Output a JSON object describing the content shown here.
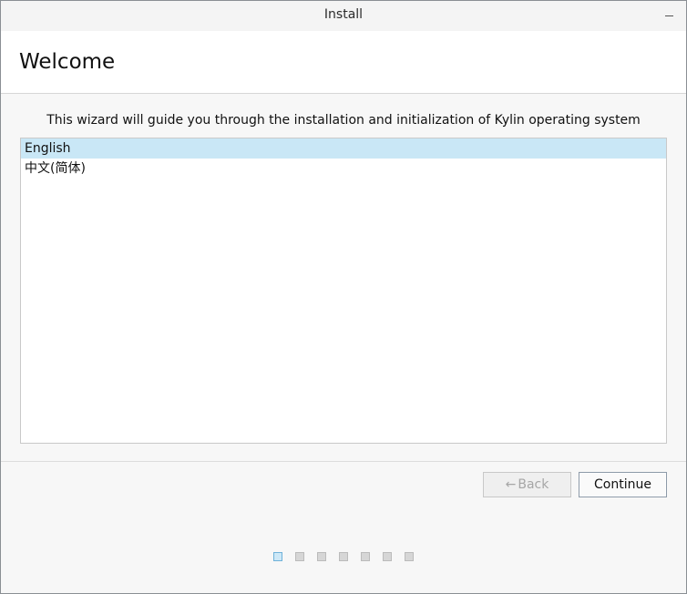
{
  "window": {
    "title": "Install"
  },
  "header": {
    "title": "Welcome"
  },
  "content": {
    "description": "This wizard will guide you through the installation and initialization of Kylin operating system",
    "languages": [
      {
        "label": "English",
        "selected": true
      },
      {
        "label": "中文(简体)",
        "selected": false
      }
    ]
  },
  "footer": {
    "back_label": "Back",
    "back_icon": "arrow-left-icon",
    "back_disabled": true,
    "continue_label": "Continue"
  },
  "steps": {
    "total": 7,
    "current": 1
  },
  "colors": {
    "selection": "#c9e7f6",
    "active_step": "#cde8f7"
  }
}
